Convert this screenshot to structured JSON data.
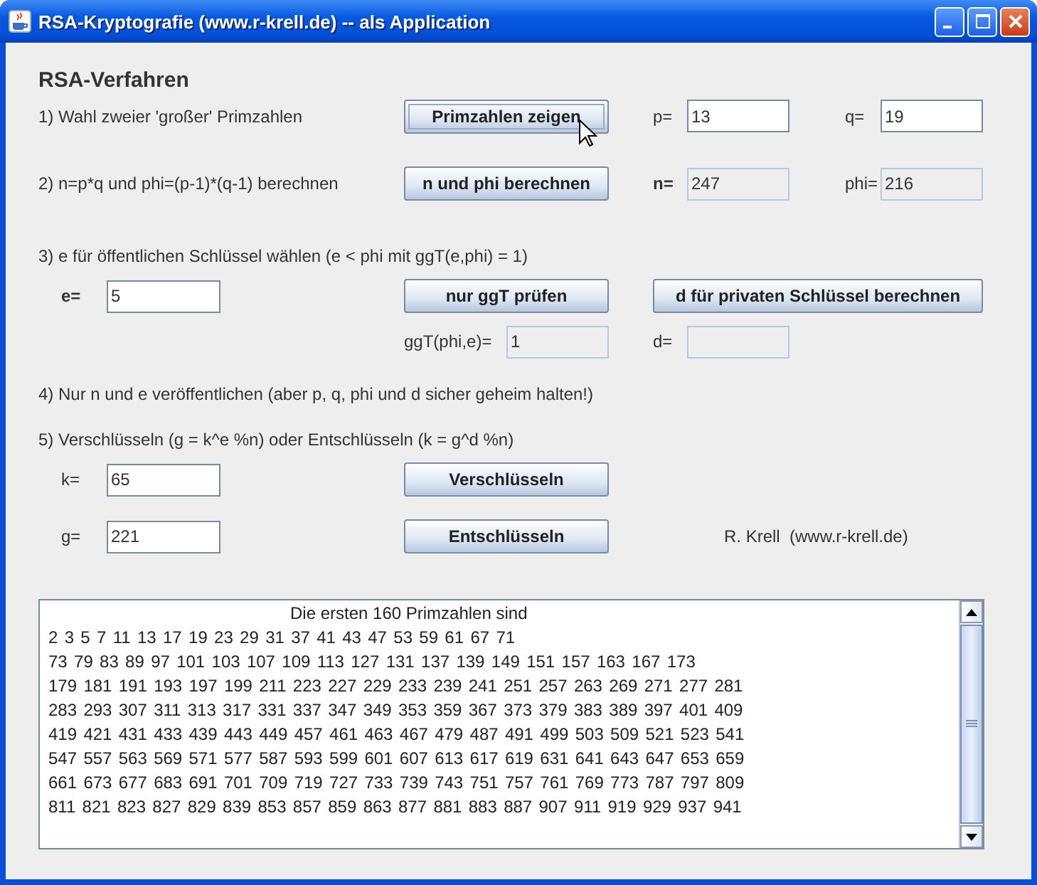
{
  "window": {
    "title": "RSA-Kryptografie (www.r-krell.de) -- als Application"
  },
  "heading": "RSA-Verfahren",
  "step1": {
    "text": "1) Wahl zweier 'großer' Primzahlen",
    "button": {
      "label": "Primzahlen zeigen",
      "focused": true
    },
    "fields": [
      {
        "label": "p=",
        "value": "13",
        "disabled": false,
        "emphasis": false
      },
      {
        "label": "q=",
        "value": "19",
        "disabled": false,
        "emphasis": false
      }
    ]
  },
  "step2": {
    "text": "2) n=p*q und phi=(p-1)*(q-1) berechnen",
    "button": {
      "label": "n und phi berechnen",
      "focused": false
    },
    "fields": [
      {
        "label": "n=",
        "value": "247",
        "disabled": true,
        "emphasis": true
      },
      {
        "label": "phi=",
        "value": "216",
        "disabled": true,
        "emphasis": false
      }
    ]
  },
  "step3": {
    "text": "3) e für öffentlichen Schlüssel wählen (e < phi mit ggT(e,phi) = 1)",
    "field": {
      "label": "e=",
      "value": "5",
      "disabled": false,
      "emphasis": true
    },
    "buttons": [
      {
        "label": "nur ggT prüfen",
        "focused": false
      },
      {
        "label": "d für privaten Schlüssel berechnen",
        "focused": false
      }
    ],
    "results": [
      {
        "label": "ggT(phi,e)=",
        "value": "1",
        "disabled": true,
        "emphasis": false
      },
      {
        "label": "d=",
        "disabled": true,
        "emphasis": false
      }
    ]
  },
  "step4": {
    "text": "4) Nur n und e veröffentlichen (aber p, q, phi und d sicher geheim halten!)"
  },
  "step5": {
    "text": "5) Verschlüsseln (g = k^e %n) oder Entschlüsseln (k = g^d %n)",
    "rows": [
      {
        "label": "k=",
        "value": "65",
        "disabled": false,
        "emphasis": false,
        "button": {
          "label": "Verschlüsseln",
          "focused": false
        }
      },
      {
        "label": "g=",
        "value": "221",
        "disabled": false,
        "emphasis": false,
        "button": {
          "label": "Entschlüsseln",
          "focused": false
        }
      }
    ],
    "credit": "R. Krell  (www.r-krell.de)"
  },
  "output": {
    "heading": "Die ersten 160 Primzahlen sind",
    "lines": [
      "2  3  5  7  11  13  17  19  23  29  31  37  41  43  47  53  59  61  67  71",
      "73  79  83  89  97  101  103  107  109  113  127  131  137  139  149  151  157  163  167  173",
      "179  181  191  193  197  199  211  223  227  229  233  239  241  251  257  263  269  271  277  281",
      "283  293  307  311  313  317  331  337  347  349  353  359  367  373  379  383  389  397  401  409",
      "419  421  431  433  439  443  449  457  461  463  467  479  487  491  499  503  509  521  523  541",
      "547  557  563  569  571  577  587  593  599  601  607  613  617  619  631  641  643  647  653  659",
      "661  673  677  683  691  701  709  719  727  733  739  743  751  757  761  769  773  787  797  809",
      "811  821  823  827  829  839  853  857  859  863  877  881  883  887  907  911  919  929  937  941"
    ]
  }
}
